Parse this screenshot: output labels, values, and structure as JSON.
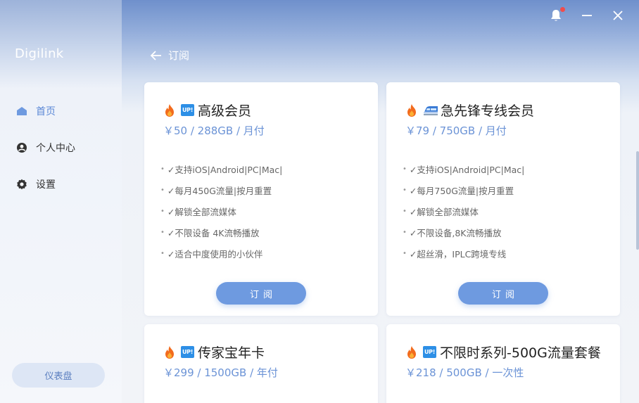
{
  "sidebar": {
    "brand": "Digilink",
    "items": [
      {
        "label": "首页",
        "icon": "home-icon",
        "active": true
      },
      {
        "label": "个人中心",
        "icon": "user-icon",
        "active": false
      },
      {
        "label": "设置",
        "icon": "gear-icon",
        "active": false
      }
    ],
    "dashboard_label": "仪表盘"
  },
  "header": {
    "back_label": "订阅"
  },
  "colors": {
    "accent": "#6e9ae0",
    "price": "#6b93d6",
    "badge": "#2d8fe6",
    "notification": "#f04c4c"
  },
  "plans": [
    {
      "title": "高级会员",
      "badge": "UP!",
      "price": "￥50 / 288GB / 月付",
      "features": [
        "✓支持iOS|Android|PC|Mac|",
        "✓每月450G流量|按月重置",
        "✓解锁全部流媒体",
        "✓不限设备 4K流畅播放",
        "✓适合中度使用的小伙伴"
      ],
      "button": "订阅"
    },
    {
      "title": "急先锋专线会员",
      "badge": "train-icon",
      "price": "￥79 / 750GB / 月付",
      "features": [
        "✓支持iOS|Android|PC|Mac|",
        "✓每月750G流量|按月重置",
        "✓解锁全部流媒体",
        "✓不限设备,8K流畅播放",
        "✓超丝滑，IPLC跨境专线"
      ],
      "button": "订阅"
    },
    {
      "title": "传家宝年卡",
      "badge": "UP!",
      "price": "￥299 / 1500GB / 年付"
    },
    {
      "title": "不限时系列-500G流量套餐",
      "badge": "UP!",
      "price": "￥218 / 500GB / 一次性"
    }
  ]
}
